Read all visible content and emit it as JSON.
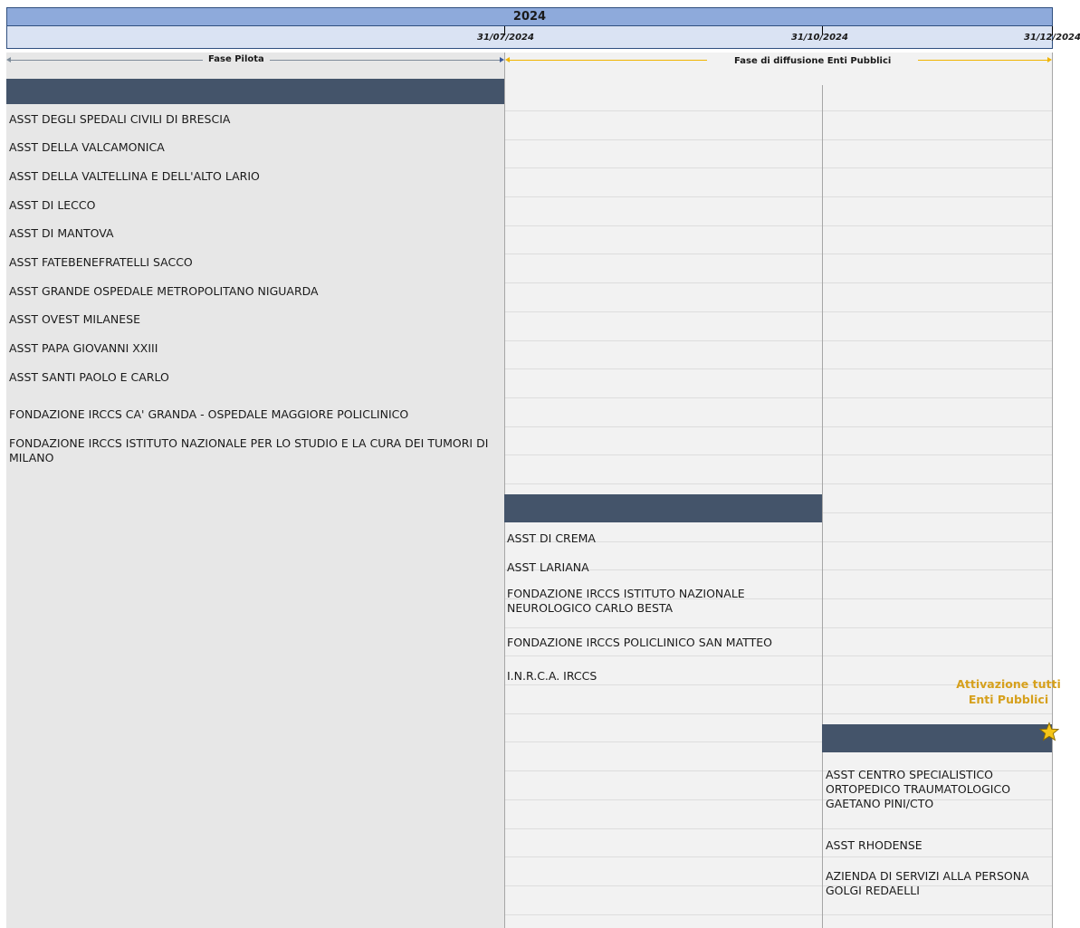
{
  "header": {
    "year": "2024",
    "dates": [
      "31/07/2024",
      "31/10/2024",
      "31/12/2024"
    ]
  },
  "phases": {
    "pilot_label": "Fase Pilota",
    "diffusion_label": "Fase di diffusione Enti Pubblici"
  },
  "groups": [
    {
      "items": [
        "ASST DEGLI SPEDALI CIVILI DI BRESCIA",
        "ASST DELLA VALCAMONICA",
        "ASST DELLA VALTELLINA E DELL'ALTO LARIO",
        "ASST DI LECCO",
        "ASST DI MANTOVA",
        "ASST FATEBENEFRATELLI SACCO",
        "ASST GRANDE OSPEDALE METROPOLITANO NIGUARDA",
        "ASST OVEST MILANESE",
        "ASST PAPA GIOVANNI XXIII",
        "ASST SANTI PAOLO E CARLO",
        "FONDAZIONE IRCCS CA' GRANDA - OSPEDALE MAGGIORE POLICLINICO",
        "FONDAZIONE IRCCS ISTITUTO NAZIONALE PER LO STUDIO E LA CURA DEI TUMORI DI MILANO"
      ]
    },
    {
      "items": [
        "ASST DI CREMA",
        "ASST LARIANA",
        "FONDAZIONE IRCCS ISTITUTO NAZIONALE NEUROLOGICO CARLO BESTA",
        "FONDAZIONE IRCCS POLICLINICO SAN MATTEO",
        "I.N.R.C.A. IRCCS"
      ]
    },
    {
      "items": [
        "ASST CENTRO SPECIALISTICO ORTOPEDICO TRAUMATOLOGICO GAETANO PINI/CTO",
        "ASST RHODENSE",
        "AZIENDA DI SERVIZI ALLA PERSONA GOLGI REDAELLI"
      ]
    }
  ],
  "milestone": {
    "label": "Attivazione tutti Enti Pubblici",
    "icon": "star-icon",
    "color": "#f5c518"
  },
  "colors": {
    "year_bar": "#8eaadb",
    "date_bar": "#dae3f3",
    "group_bar": "#44546a",
    "pilot_arrow": "#7f8c9a",
    "diffusion_arrow": "#f0b400"
  }
}
